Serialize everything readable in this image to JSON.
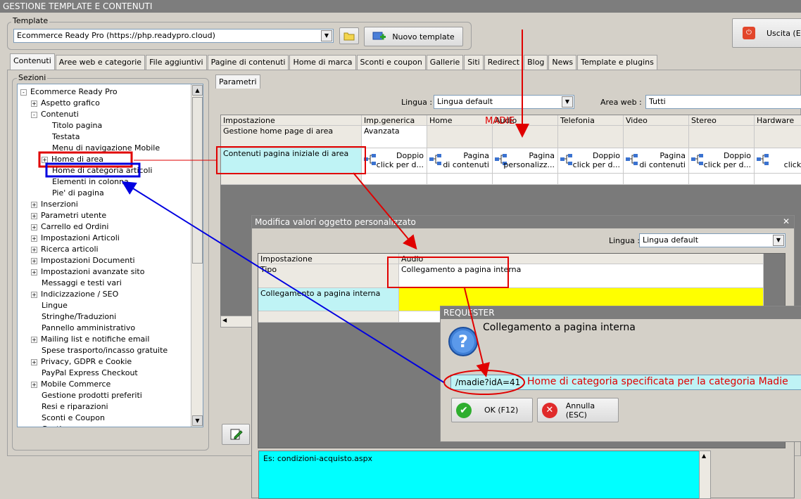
{
  "window_title": "GESTIONE TEMPLATE E CONTENUTI",
  "template": {
    "label": "Template",
    "value": "Ecommerce Ready Pro (https://php.readypro.cloud)",
    "new_button": "Nuovo template",
    "exit_button": "Uscita (Es"
  },
  "tabs": [
    "Contenuti",
    "Aree web e categorie",
    "File aggiuntivi",
    "Pagine di contenuti",
    "Home di marca",
    "Sconti e coupon",
    "Gallerie",
    "Siti",
    "Redirect",
    "Blog",
    "News",
    "Template e plugins"
  ],
  "sections": {
    "label": "Sezioni",
    "tree": [
      {
        "label": "Ecommerce Ready Pro",
        "level": 0,
        "exp": "-"
      },
      {
        "label": "Aspetto grafico",
        "level": 1,
        "exp": "+"
      },
      {
        "label": "Contenuti",
        "level": 1,
        "exp": "-"
      },
      {
        "label": "Titolo pagina",
        "level": 2,
        "exp": ""
      },
      {
        "label": "Testata",
        "level": 2,
        "exp": ""
      },
      {
        "label": "Menu di navigazione Mobile",
        "level": 2,
        "exp": ""
      },
      {
        "label": "Home di area",
        "level": 2,
        "exp": "+"
      },
      {
        "label": "Home di categoria articoli",
        "level": 2,
        "exp": ""
      },
      {
        "label": "Elementi in colonna",
        "level": 2,
        "exp": ""
      },
      {
        "label": "Pie' di pagina",
        "level": 2,
        "exp": ""
      },
      {
        "label": "Inserzioni",
        "level": 1,
        "exp": "+"
      },
      {
        "label": "Parametri utente",
        "level": 1,
        "exp": "+"
      },
      {
        "label": "Carrello ed Ordini",
        "level": 1,
        "exp": "+"
      },
      {
        "label": "Impostazioni Articoli",
        "level": 1,
        "exp": "+"
      },
      {
        "label": "Ricerca articoli",
        "level": 1,
        "exp": "+"
      },
      {
        "label": "Impostazioni Documenti",
        "level": 1,
        "exp": "+"
      },
      {
        "label": "Impostazioni avanzate sito",
        "level": 1,
        "exp": "+"
      },
      {
        "label": "Messaggi e testi vari",
        "level": 1,
        "exp": ""
      },
      {
        "label": "Indicizzazione / SEO",
        "level": 1,
        "exp": "+"
      },
      {
        "label": "Lingue",
        "level": 1,
        "exp": ""
      },
      {
        "label": "Stringhe/Traduzioni",
        "level": 1,
        "exp": ""
      },
      {
        "label": "Pannello amministrativo",
        "level": 1,
        "exp": ""
      },
      {
        "label": "Mailing list e notifiche email",
        "level": 1,
        "exp": "+"
      },
      {
        "label": "Spese trasporto/incasso gratuite",
        "level": 1,
        "exp": ""
      },
      {
        "label": "Privacy, GDPR e Cookie",
        "level": 1,
        "exp": "+"
      },
      {
        "label": "PayPal Express Checkout",
        "level": 1,
        "exp": ""
      },
      {
        "label": "Mobile Commerce",
        "level": 1,
        "exp": "+"
      },
      {
        "label": "Gestione prodotti preferiti",
        "level": 1,
        "exp": ""
      },
      {
        "label": "Resi e riparazioni",
        "level": 1,
        "exp": ""
      },
      {
        "label": "Sconti e Coupon",
        "level": 1,
        "exp": ""
      },
      {
        "label": "Gestione ...",
        "level": 1,
        "exp": ""
      }
    ]
  },
  "params": {
    "tab": "Parametri",
    "lingua_label": "Lingua :",
    "lingua_value": "Lingua default",
    "area_label": "Area web :",
    "area_value": "Tutti",
    "columns": [
      "Impostazione",
      "Imp.generica",
      "Home",
      "Audio",
      "Telefonia",
      "Video",
      "Stereo",
      "Hardware"
    ],
    "row1": {
      "label": "Gestione home page di area",
      "generic": "Avanzata"
    },
    "row2": {
      "label": "Contenuti pagina iniziale di area",
      "cells": [
        [
          "Doppio",
          "click per d..."
        ],
        [
          "Pagina",
          "di contenuti"
        ],
        [
          "Pagina",
          "personalizz..."
        ],
        [
          "Doppio",
          "click per d..."
        ],
        [
          "Pagina",
          "di contenuti"
        ],
        [
          "Doppio",
          "click per d..."
        ],
        [
          "Dop",
          "click per"
        ]
      ]
    }
  },
  "dialog": {
    "title": "Modifica valori oggetto personalizzato",
    "lingua_label": "Lingua :",
    "lingua_value": "Lingua default",
    "col1": "Impostazione",
    "col2": "Audio",
    "row1_label": "Tipo",
    "row1_value": "Collegamento a pagina interna",
    "row2_label": "Collegamento a pagina interna",
    "hint": "Es: condizioni-acquisto.aspx"
  },
  "requester": {
    "title": "REQUESTER",
    "message": "Collegamento a pagina interna",
    "input_value": "/madie?idA=41",
    "ok": "OK (F12)",
    "cancel": "Annulla (ESC)"
  },
  "annotations": {
    "madie": "MADIE",
    "note": "Home di categoria specificata per la categoria Madie"
  },
  "colors": {
    "annotation_red": "#e00000",
    "annotation_blue": "#0000e0",
    "highlight_yellow": "#ffff00",
    "hint_cyan": "#00ffff"
  }
}
